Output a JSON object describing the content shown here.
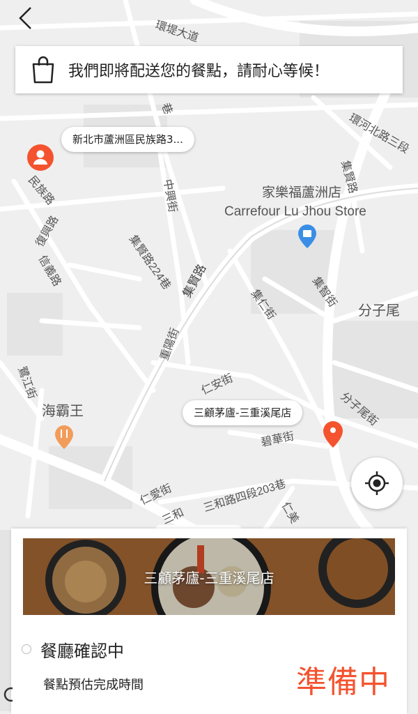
{
  "banner": {
    "message": "我們即將配送您的餐點，請耐心等候！"
  },
  "map": {
    "user_address": "新北市蘆洲區民族路3...",
    "restaurant_pill": "三顧茅廬-三重溪尾店",
    "labels": {
      "huandi": "環堤大道",
      "xiang": "巷",
      "huanhe": "環河北路三段",
      "jixian": "集賢路",
      "minzu": "民族路",
      "fuxing": "復興路",
      "xinyi": "信義路",
      "zhongxing": "中興街",
      "jimao": "集賢路224巷",
      "jimaolu": "集賢路",
      "carrefour_zh": "家樂福蘆洲店",
      "carrefour_en": "Carrefour Lu Jhou Store",
      "jizhi": "集智街",
      "jiren": "集仁街",
      "fenziwei": "分子尾",
      "chongyang": "重陽街",
      "renan": "仁安街",
      "lujiang": "鷺江街",
      "haibawang": "海霸王",
      "fenziweijie": "分子尾街",
      "bihua": "碧華街",
      "renai": "仁愛街",
      "sanhe": "三和路四段203巷",
      "renmei": "仁美",
      "san": "三和"
    },
    "colors": {
      "accent": "#f4532f",
      "pin_blue": "#3a8ee6",
      "food_orange": "#f29c5b"
    }
  },
  "sheet": {
    "restaurant_name": "三顧茅廬-三重溪尾店",
    "status_label": "餐廳確認中",
    "eta_label": "餐點預估完成時間",
    "big_status": "準備中"
  },
  "icons": {
    "back": "chevron-left-icon",
    "bag": "shopping-bag-icon",
    "user_pin": "user-location-pin-icon",
    "restaurant_pin": "restaurant-pin-icon",
    "locate": "locate-crosshair-icon"
  }
}
